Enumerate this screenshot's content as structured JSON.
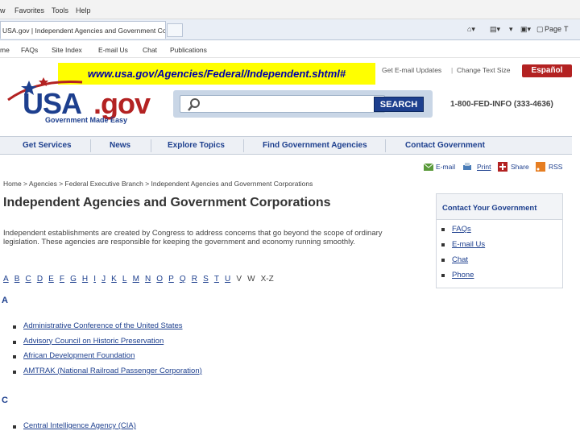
{
  "browser": {
    "menu": [
      "w",
      "Favorites",
      "Tools",
      "Help"
    ],
    "tab_title": "USA.gov | Independent Agencies and Government Co...",
    "tools": {
      "page": "Page",
      "tools_label": "T"
    },
    "links_bar": [
      "me",
      "FAQs",
      "Site Index",
      "E-mail Us",
      "Chat",
      "Publications"
    ]
  },
  "header": {
    "url_overlay": "www.usa.gov/Agencies/Federal/Independent.shtml#",
    "links": [
      "Get E-mail Updates",
      "Change Text Size"
    ],
    "espanol": "Español",
    "logo_usa": "USA",
    "logo_gov": ".gov",
    "logo_tagline": "Government Made Easy",
    "search_button": "SEARCH",
    "phone": "1-800-FED-INFO (333-4636)"
  },
  "nav": [
    "Get Services",
    "News",
    "Explore Topics",
    "Find Government Agencies",
    "Contact Government"
  ],
  "share": [
    "E-mail",
    "Print",
    "Share",
    "RSS"
  ],
  "breadcrumb": "Home > Agencies > Federal Executive Branch > Independent Agencies and Government Corporations",
  "page_title": "Independent Agencies and Government Corporations",
  "intro": "Independent establishments are created by Congress to address concerns that go beyond the scope of ordinary legislation. These agencies are responsible for keeping the government and economy running smoothly.",
  "alphabet": [
    "A",
    "B",
    "C",
    "D",
    "E",
    "F",
    "G",
    "H",
    "I",
    "J",
    "K",
    "L",
    "M",
    "N",
    "O",
    "P",
    "Q",
    "R",
    "S",
    "T",
    "U",
    "V",
    "W",
    "X-Z"
  ],
  "sections": [
    {
      "letter": "A",
      "agencies": [
        "Administrative Conference of the United States",
        "Advisory Council on Historic Preservation",
        "African Development Foundation",
        "AMTRAK (National Railroad Passenger Corporation)"
      ]
    },
    {
      "letter": "C",
      "agencies": [
        "Central Intelligence Agency (CIA)"
      ]
    }
  ],
  "sidebar": {
    "title": "Contact Your Government",
    "links": [
      "FAQs",
      "E-mail Us",
      "Chat",
      "Phone"
    ]
  },
  "colors": {
    "brand_blue": "#1d3f8e",
    "brand_red": "#b32222",
    "highlight": "#ffff00"
  }
}
